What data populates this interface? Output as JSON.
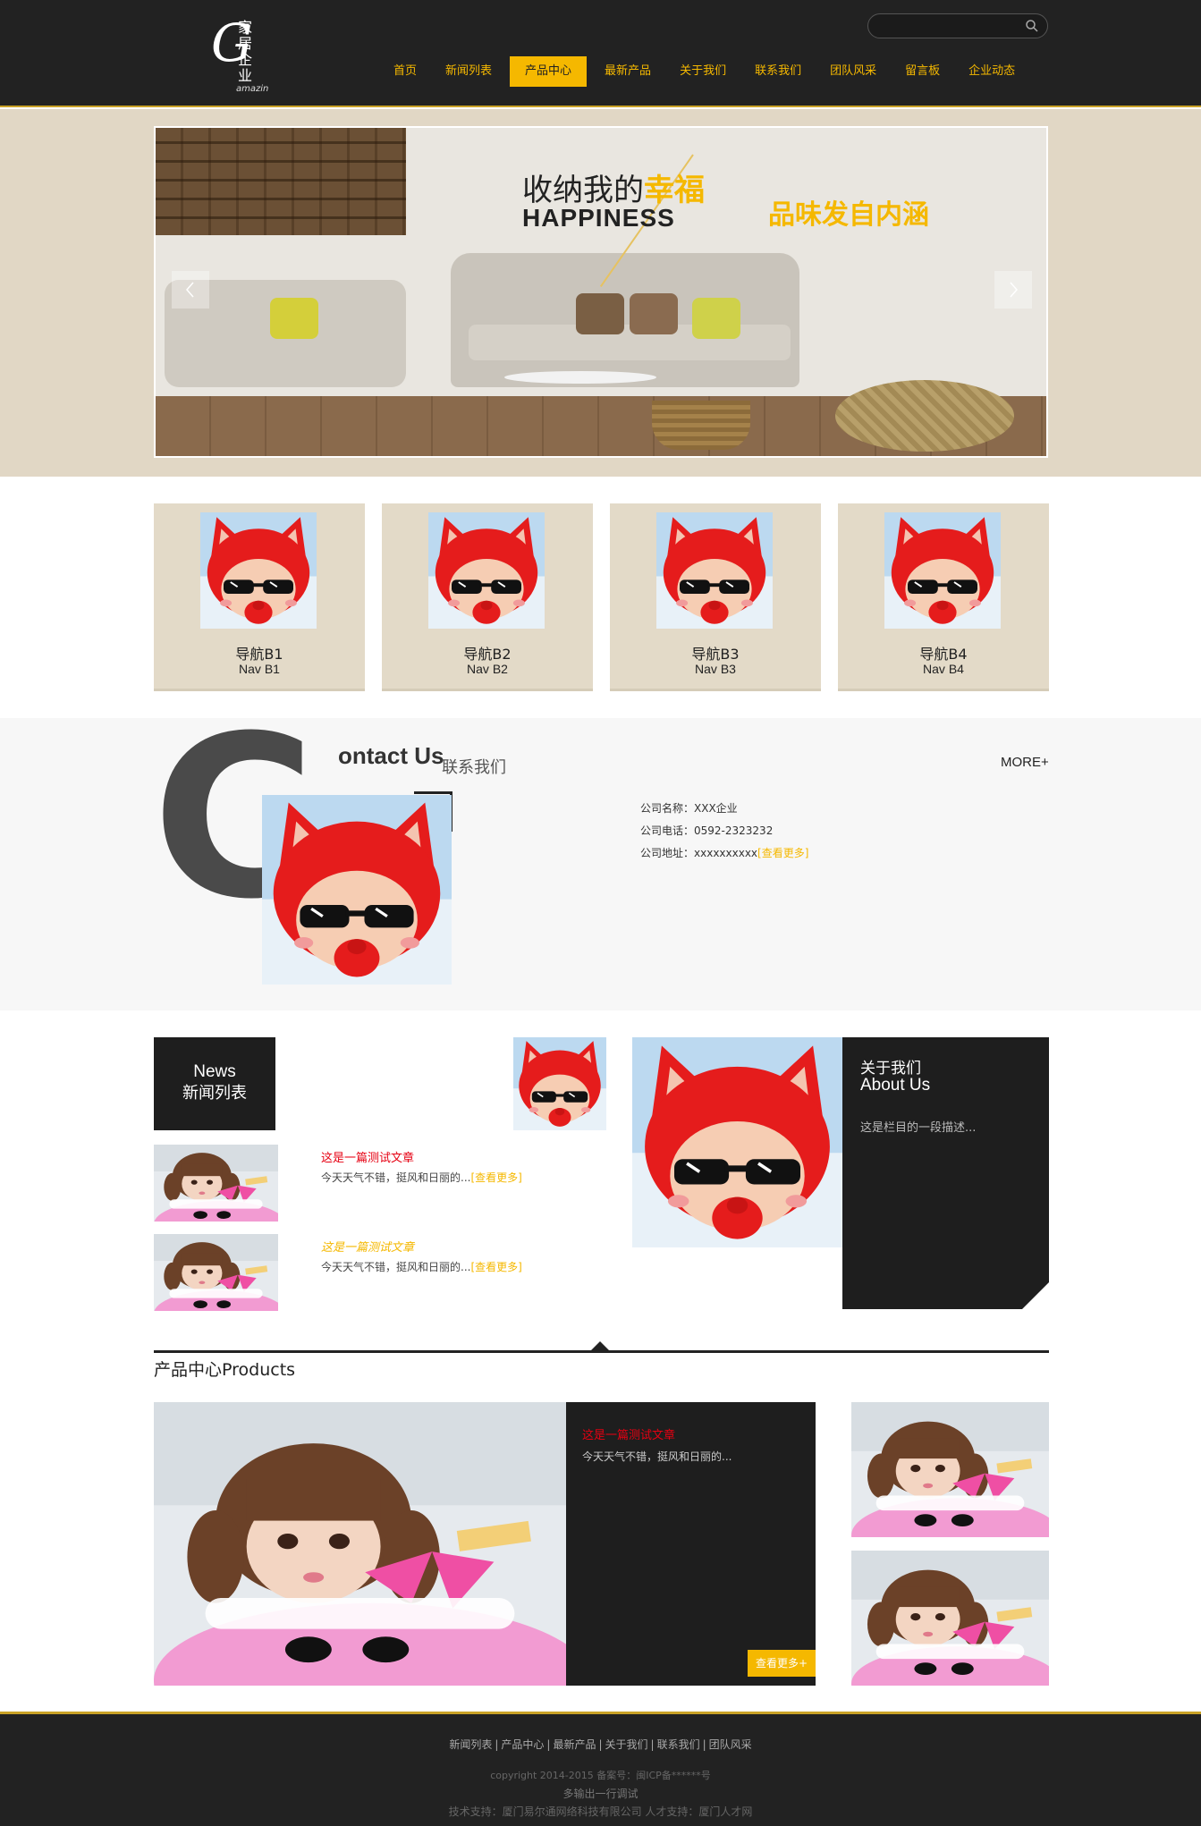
{
  "header": {
    "logo_main": "G",
    "logo_side": "家居企业",
    "logo_sub": "amazin",
    "search_placeholder": "",
    "nav": [
      {
        "label": "首页",
        "active": false
      },
      {
        "label": "新闻列表",
        "active": false
      },
      {
        "label": "产品中心",
        "active": true
      },
      {
        "label": "最新产品",
        "active": false
      },
      {
        "label": "关于我们",
        "active": false
      },
      {
        "label": "联系我们",
        "active": false
      },
      {
        "label": "团队风采",
        "active": false
      },
      {
        "label": "留言板",
        "active": false
      },
      {
        "label": "企业动态",
        "active": false
      }
    ]
  },
  "banner": {
    "line1_prefix": "收纳我的",
    "line1_highlight": "幸福",
    "line2": "HAPPINESS",
    "line3": "品味发自内涵"
  },
  "nav_boxes": [
    {
      "cn": "导航B1",
      "en": "Nav B1"
    },
    {
      "cn": "导航B2",
      "en": "Nav B2"
    },
    {
      "cn": "导航B3",
      "en": "Nav B3"
    },
    {
      "cn": "导航B4",
      "en": "Nav B4"
    }
  ],
  "contact": {
    "big_letter": "C",
    "title_en": "ontact Us",
    "title_cn": "联系我们",
    "more": "MORE+",
    "company_label": "公司名称：",
    "company_value": "XXX企业",
    "phone_label": "公司电话：",
    "phone_value": "0592-2323232",
    "address_label": "公司地址：",
    "address_value": "xxxxxxxxxx",
    "address_link": "[查看更多]"
  },
  "news": {
    "head_en": "News",
    "head_cn": "新闻列表",
    "items": [
      {
        "title": "这是一篇测试文章",
        "desc": "今天天气不错，挺风和日丽的...",
        "more": "[查看更多]"
      },
      {
        "title": "这是一篇测试文章",
        "desc": "今天天气不错，挺风和日丽的...",
        "more": "[查看更多]"
      }
    ]
  },
  "about": {
    "title_cn": "关于我们",
    "title_en": "About Us",
    "desc": "这是栏目的一段描述..."
  },
  "products": {
    "title": "产品中心Products",
    "feature_title": "这是一篇测试文章",
    "feature_desc": "今天天气不错，挺风和日丽的...",
    "feature_button": "查看更多+"
  },
  "footer": {
    "links": [
      "新闻列表",
      "产品中心",
      "最新产品",
      "关于我们",
      "联系我们",
      "团队风采"
    ],
    "copyright": "copyright 2014-2015 备案号：闽ICP备******号",
    "line2": "多输出一行调试",
    "line3": "技术支持：厦门易尔通网络科技有限公司 人才支持：厦门人才网"
  },
  "colors": {
    "accent": "#f5b800",
    "dark": "#222222",
    "beige": "#e1d7c5",
    "red_title": "#e60012"
  }
}
